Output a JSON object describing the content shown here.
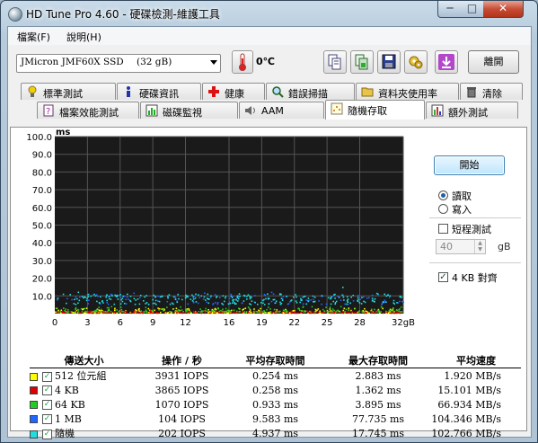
{
  "window": {
    "title": "HD Tune Pro 4.60 - 硬碟檢測-維護工具",
    "minimize": "─",
    "maximize": "□",
    "close": "✕"
  },
  "menu": {
    "file": "檔案(F)",
    "help": "說明(H)"
  },
  "toolbar": {
    "drive_name": "JMicron JMF60X SSD",
    "drive_size": "(32 gB)",
    "temperature": "0℃",
    "exit_label": "離開",
    "icons": [
      "thermometer-icon",
      "copy-text-icon",
      "copy-screenshot-icon",
      "save-icon",
      "options-icon",
      "download-icon"
    ]
  },
  "tabs": {
    "row1": [
      "標準測試",
      "硬碟資訊",
      "健康",
      "錯誤掃描",
      "資料夾使用率",
      "清除"
    ],
    "row2": [
      "檔案效能測試",
      "磁碟監視",
      "AAM",
      "隨機存取",
      "額外測試"
    ],
    "active": "隨機存取"
  },
  "side": {
    "start_label": "開始",
    "read_label": "讀取",
    "write_label": "寫入",
    "short_test_label": "短程測試",
    "short_test_checked": false,
    "size_value": "40",
    "size_unit": "gB",
    "align_label": "4 KB 對齊",
    "align_checked": true,
    "mode": "read"
  },
  "chart_data": {
    "type": "scatter",
    "ylabel": "ms",
    "xlabel_unit": "32gB",
    "ylim": [
      0,
      100
    ],
    "xlim": [
      0,
      32
    ],
    "y_ticks": [
      "100.0",
      "90.0",
      "80.0",
      "70.0",
      "60.0",
      "50.0",
      "40.0",
      "30.0",
      "20.0",
      "10.0"
    ],
    "x_ticks": [
      "0",
      "3",
      "6",
      "9",
      "12",
      "16",
      "19",
      "22",
      "25",
      "28",
      "32gB"
    ],
    "grid": true,
    "background": "#1a1a1a",
    "series": [
      {
        "name": "512 位元組",
        "color": "#ffff00",
        "typical_ms": [
          0.2,
          2.9
        ]
      },
      {
        "name": "4 KB",
        "color": "#dd0000",
        "typical_ms": [
          0.2,
          1.4
        ]
      },
      {
        "name": "64 KB",
        "color": "#22cc22",
        "typical_ms": [
          0.9,
          3.9
        ]
      },
      {
        "name": "1 MB",
        "color": "#2266ff",
        "typical_ms": [
          9.5,
          77.7
        ]
      },
      {
        "name": "隨機",
        "color": "#22dddd",
        "typical_ms": [
          4.9,
          17.7
        ]
      }
    ]
  },
  "results": {
    "headers": [
      "傳送大小",
      "操作 / 秒",
      "平均存取時間",
      "最大存取時間",
      "平均速度"
    ],
    "rows": [
      {
        "label": "512 位元組",
        "color": "#ffff00",
        "ops": "3931 IOPS",
        "avg": "0.254 ms",
        "max": "2.883 ms",
        "speed": "1.920 MB/s"
      },
      {
        "label": "4 KB",
        "color": "#dd0000",
        "ops": "3865 IOPS",
        "avg": "0.258 ms",
        "max": "1.362 ms",
        "speed": "15.101 MB/s"
      },
      {
        "label": "64 KB",
        "color": "#22cc22",
        "ops": "1070 IOPS",
        "avg": "0.933 ms",
        "max": "3.895 ms",
        "speed": "66.934 MB/s"
      },
      {
        "label": "1 MB",
        "color": "#2266ff",
        "ops": "104 IOPS",
        "avg": "9.583 ms",
        "max": "77.735 ms",
        "speed": "104.346 MB/s"
      },
      {
        "label": "隨機",
        "color": "#22dddd",
        "ops": "202 IOPS",
        "avg": "4.937 ms",
        "max": "17.745 ms",
        "speed": "102.766 MB/s"
      }
    ]
  }
}
